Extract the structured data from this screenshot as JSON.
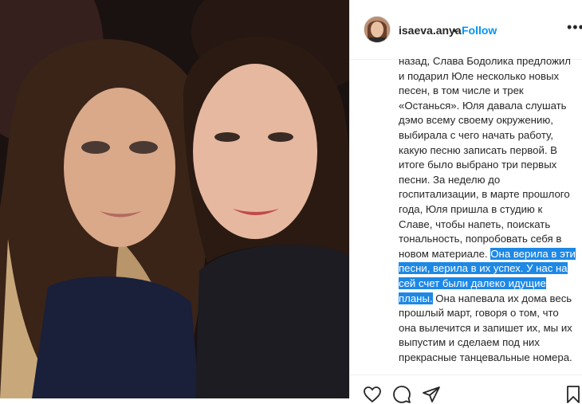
{
  "post": {
    "username": "isaeva.anya",
    "separator": "•",
    "follow_label": "Follow",
    "more_label": "•••",
    "caption_plain_before": "назад, Слава Бодолика предложил и подарил Юле несколько новых песен, в том числе и трек «Останься». Юля давала слушать дэмо всему своему окружению, выбирала с чего начать работу, какую песню записать первой. В итоге было выбрано три первых песни. За неделю до госпитализации, в марте прошлого года, Юля пришла в студию к Славе, чтобы напеть, поискать тональность, попробовать себя в новом материале. ",
    "caption_highlighted": "Она верила в эти песни, верила в их успех. У нас на сей счет были далеко идущие планы.",
    "caption_plain_after": " Она напевала их дома весь прошлый март, говоря о том, что она вылечится и запишет их, мы их выпустим и сделаем под них прекрасные танцевальные номера."
  },
  "actions": {
    "icons": [
      "heart-icon",
      "comment-icon",
      "share-icon",
      "bookmark-icon"
    ]
  },
  "colors": {
    "accent": "#0095f6",
    "highlight": "#1e88e5"
  }
}
